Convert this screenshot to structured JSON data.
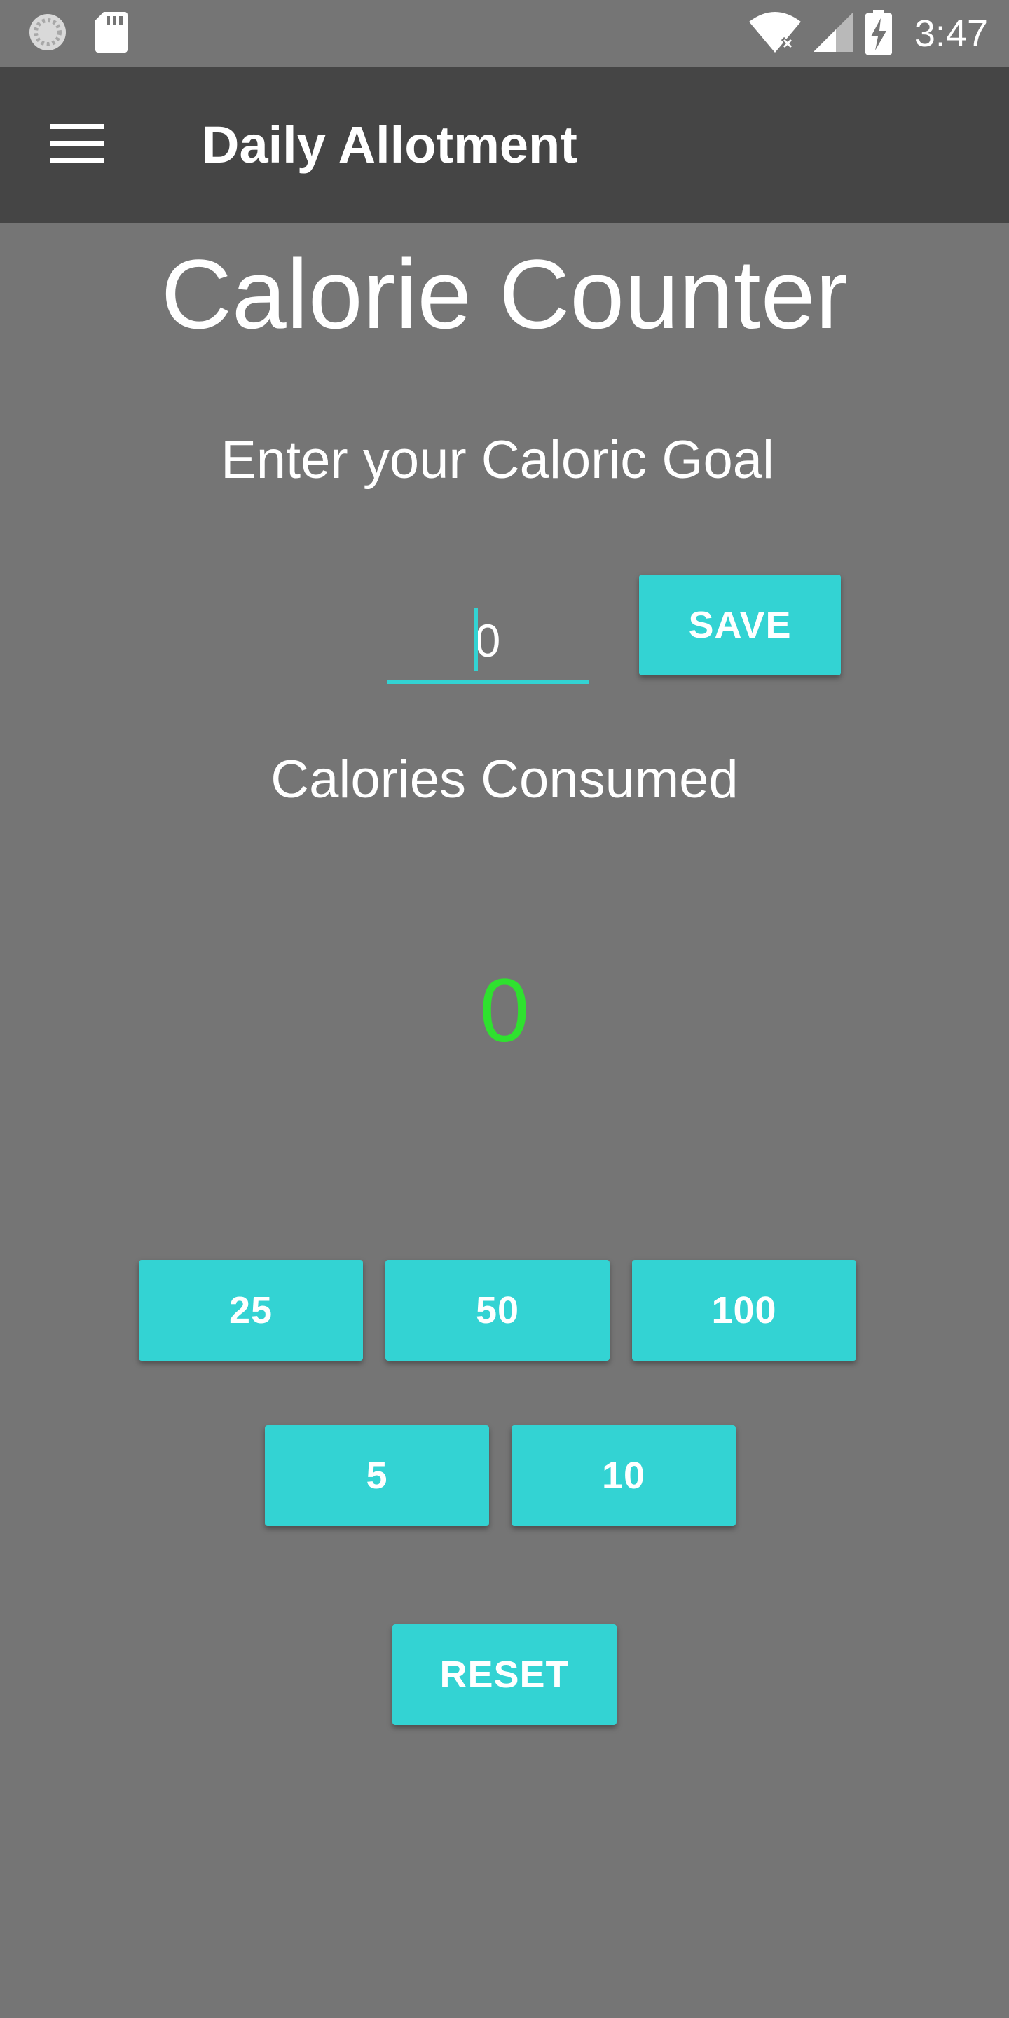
{
  "status_bar": {
    "time": "3:47",
    "icons": [
      "sync-icon",
      "sd-card-icon",
      "wifi-icon",
      "cellular-signal-icon",
      "battery-charging-icon"
    ]
  },
  "app_bar": {
    "title": "Daily Allotment",
    "menu_icon": "hamburger-menu-icon"
  },
  "main": {
    "title": "Calorie Counter",
    "goal_label": "Enter your Caloric Goal",
    "goal_input_value": "0",
    "save_label": "SAVE",
    "consumed_label": "Calories Consumed",
    "consumed_value": "0",
    "increment_buttons": [
      "25",
      "50",
      "100",
      "5",
      "10"
    ],
    "reset_label": "RESET"
  },
  "colors": {
    "background": "#757575",
    "app_bar": "#454545",
    "accent": "#33d3d3",
    "consumed_value": "#2fe12f",
    "text": "#ffffff"
  }
}
